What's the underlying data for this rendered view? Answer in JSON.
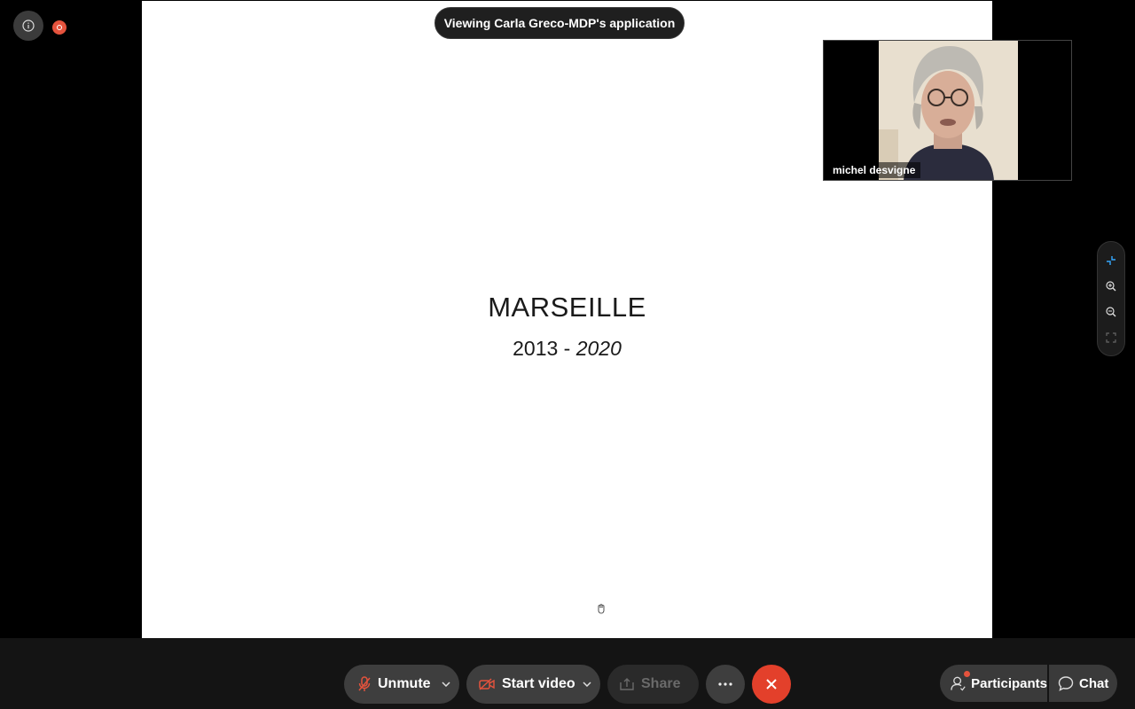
{
  "banner": {
    "viewing_text": "Viewing Carla Greco-MDP's application"
  },
  "slide": {
    "title": "MARSEILLE",
    "years_start": "2013 -",
    "years_end": "2020"
  },
  "video": {
    "participant_name": "michel desvigne"
  },
  "toolbar": {
    "unmute_label": "Unmute",
    "start_video_label": "Start video",
    "share_label": "Share",
    "participants_label": "Participants",
    "chat_label": "Chat"
  },
  "icons": {
    "info": "info-icon",
    "recording": "recording-icon",
    "exit_fullscreen": "exit-fullscreen-icon",
    "zoom_in": "zoom-in-icon",
    "zoom_out": "zoom-out-icon",
    "fit": "fit-screen-icon",
    "mic_muted": "mic-muted-icon",
    "camera_off": "camera-off-icon",
    "share": "share-icon",
    "more": "more-icon",
    "leave": "close-icon",
    "participants": "participants-icon",
    "chat": "chat-icon"
  },
  "colors": {
    "leave": "#e3402b",
    "recording": "#e5533d",
    "accent": "#35a8ff"
  }
}
